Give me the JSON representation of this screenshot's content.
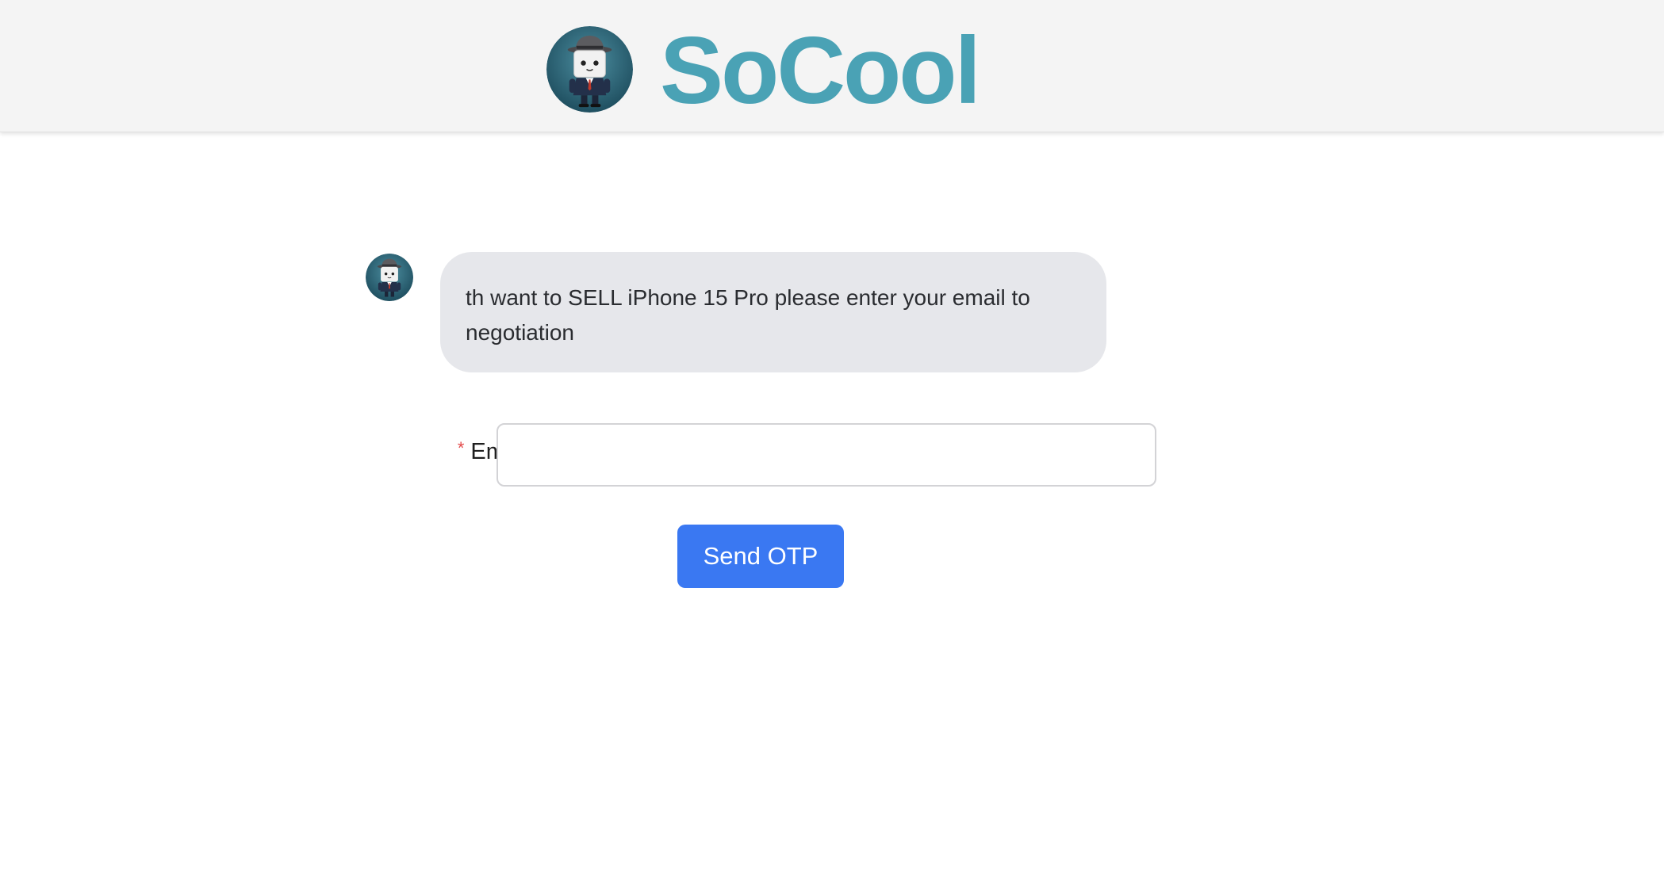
{
  "header": {
    "brand_name": "SoCool",
    "logo_icon": "robot-detective-avatar-icon"
  },
  "chat": {
    "bot_avatar_icon": "robot-detective-avatar-icon",
    "message": "th want to SELL iPhone 15 Pro please enter your email to negotiation"
  },
  "form": {
    "email_label": "Email",
    "required_mark": "*",
    "colon": ":",
    "email_value": "",
    "email_placeholder": ""
  },
  "actions": {
    "send_otp_label": "Send OTP"
  },
  "colors": {
    "brand": "#4aa2b5",
    "button": "#3a78f2",
    "bubble": "#e6e7eb",
    "header_bg": "#f4f4f4",
    "required": "#e34a4a"
  }
}
